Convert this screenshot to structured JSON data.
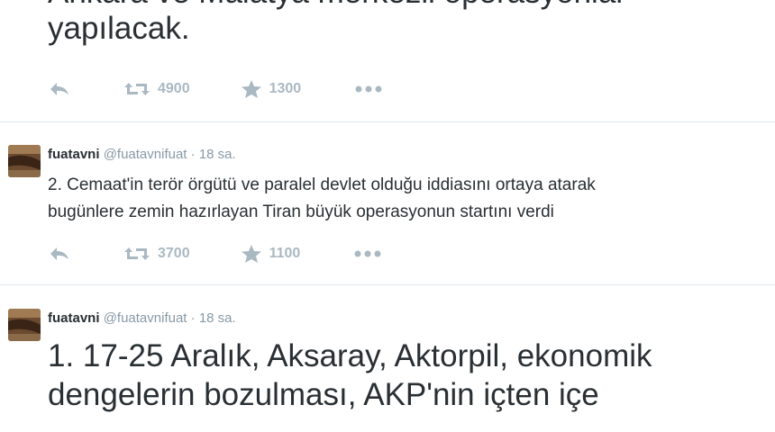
{
  "tweets": [
    {
      "text_lines": [
        "Ankara ve Malatya merkezli operasyonlar",
        "yapılacak."
      ],
      "actions": {
        "retweets": "4900",
        "favorites": "1300"
      }
    },
    {
      "name": "fuatavni",
      "handle": "@fuatavnifuat",
      "separator": "·",
      "time": "18 sa.",
      "text_lines": [
        "2. Cemaat'in terör örgütü ve paralel devlet olduğu iddiasını ortaya atarak",
        "bugünlere zemin hazırlayan Tiran büyük operasyonun startını verdi"
      ],
      "actions": {
        "retweets": "3700",
        "favorites": "1100"
      }
    },
    {
      "name": "fuatavni",
      "handle": "@fuatavnifuat",
      "separator": "·",
      "time": "18 sa.",
      "text_lines": [
        "1. 17-25 Aralık, Aksaray, Aktorpil, ekonomik",
        "dengelerin bozulması, AKP'nin içten içe"
      ]
    }
  ],
  "icons": {
    "reply": "reply-arrow-icon",
    "retweet": "retweet-icon",
    "favorite": "star-icon",
    "more": "more-dots-icon"
  },
  "colors": {
    "action_icon": "#aab8c2",
    "meta_text": "#8899a6",
    "divider": "#e1e8ed"
  }
}
